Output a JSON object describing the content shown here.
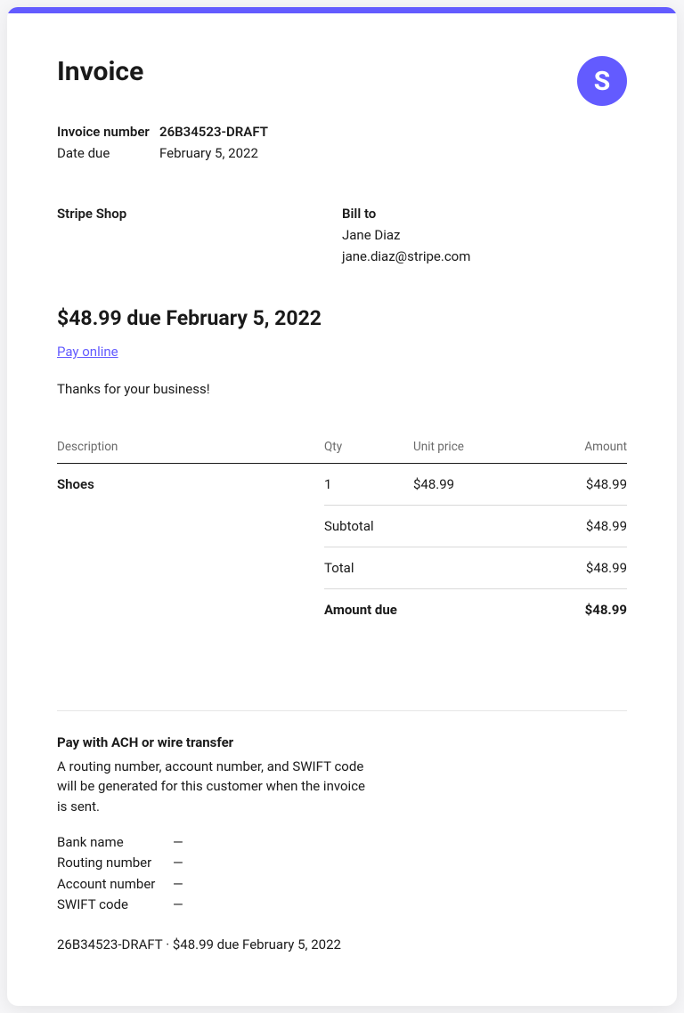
{
  "header": {
    "title": "Invoice",
    "logo_letter": "S"
  },
  "meta": {
    "invoice_number_label": "Invoice number",
    "invoice_number": "26B34523-DRAFT",
    "date_due_label": "Date due",
    "date_due": "February 5, 2022"
  },
  "from": {
    "name": "Stripe Shop"
  },
  "to": {
    "label": "Bill to",
    "name": "Jane Diaz",
    "email": "jane.diaz@stripe.com"
  },
  "due": {
    "heading": "$48.99 due February 5, 2022",
    "pay_link": "Pay online",
    "thanks": "Thanks for your business!"
  },
  "table": {
    "headers": {
      "description": "Description",
      "qty": "Qty",
      "unit_price": "Unit price",
      "amount": "Amount"
    },
    "items": [
      {
        "description": "Shoes",
        "qty": "1",
        "unit_price": "$48.99",
        "amount": "$48.99"
      }
    ],
    "summary": {
      "subtotal_label": "Subtotal",
      "subtotal": "$48.99",
      "total_label": "Total",
      "total": "$48.99",
      "amount_due_label": "Amount due",
      "amount_due": "$48.99"
    }
  },
  "payment": {
    "heading": "Pay with ACH or wire transfer",
    "description": "A routing number, account number, and SWIFT code will be generated for this customer when the invoice is sent.",
    "bank_name_label": "Bank name",
    "bank_name": "—",
    "routing_label": "Routing number",
    "routing": "—",
    "account_label": "Account number",
    "account": "—",
    "swift_label": "SWIFT code",
    "swift": "—"
  },
  "footer": {
    "line": "26B34523-DRAFT · $48.99 due February 5, 2022"
  }
}
